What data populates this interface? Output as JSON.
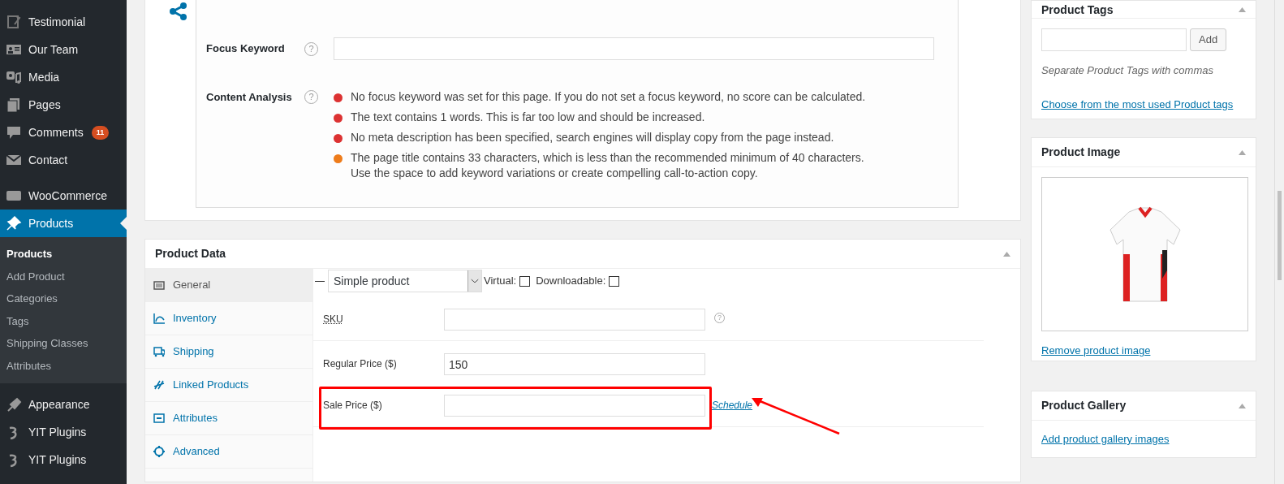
{
  "sidebar": {
    "items": [
      {
        "label": "Testimonial",
        "selected": false
      },
      {
        "label": "Our Team",
        "selected": false
      },
      {
        "label": "Media",
        "selected": false
      },
      {
        "label": "Pages",
        "selected": false
      },
      {
        "label": "Comments",
        "selected": false,
        "badge": "11"
      },
      {
        "label": "Contact",
        "selected": false
      },
      {
        "label": "WooCommerce",
        "selected": false,
        "gap_before": true
      },
      {
        "label": "Products",
        "selected": true,
        "children": [
          {
            "label": "Products",
            "selected": true
          },
          {
            "label": "Add Product",
            "selected": false
          },
          {
            "label": "Categories",
            "selected": false
          },
          {
            "label": "Tags",
            "selected": false
          },
          {
            "label": "Shipping Classes",
            "selected": false
          },
          {
            "label": "Attributes",
            "selected": false
          }
        ]
      },
      {
        "label": "Appearance",
        "selected": false,
        "gap_before": true
      },
      {
        "label": "YIT Plugins",
        "selected": false
      },
      {
        "label": "YIT Plugins",
        "selected": false
      }
    ]
  },
  "seo": {
    "focus_keyword": {
      "label": "Focus Keyword",
      "help": "?"
    },
    "content_analysis": {
      "label": "Content Analysis",
      "help": "?",
      "items": [
        {
          "text": "No focus keyword was set for this page. If you do not set a focus keyword, no score can be calculated.",
          "color": "#dc3232"
        },
        {
          "text": "The text contains 1 words. This is far too low and should be increased.",
          "color": "#dc3232"
        },
        {
          "text": "No meta description has been specified, search engines will display copy from the page instead.",
          "color": "#dc3232"
        },
        {
          "text": "The page title contains 33 characters, which is less than the recommended minimum of 40 characters.\nUse the space to add keyword variations or create compelling call-to-action copy.",
          "color": "#ee7c1b"
        }
      ]
    }
  },
  "product_data": {
    "title": "Product Data",
    "tabs": [
      {
        "label": "General",
        "selected": true
      },
      {
        "label": "Inventory",
        "selected": false
      },
      {
        "label": "Shipping",
        "selected": false
      },
      {
        "label": "Linked Products",
        "selected": false
      },
      {
        "label": "Attributes",
        "selected": false
      },
      {
        "label": "Advanced",
        "selected": false
      }
    ],
    "product_type": "Simple product",
    "options": [
      {
        "label": "Virtual:",
        "checked": false
      },
      {
        "label": "Downloadable:",
        "checked": false
      }
    ],
    "fields": [
      {
        "label": "SKU",
        "help": "?",
        "divider_after": true
      },
      {
        "label": "Regular Price ($)",
        "value": "150"
      },
      {
        "label": "Sale Price ($)",
        "highlighted": true,
        "link": "Schedule",
        "divider_after": true
      }
    ]
  },
  "product_tags": {
    "title": "Product Tags",
    "button": "Add",
    "hint": "Separate Product Tags with commas",
    "link": "Choose from the most used Product tags"
  },
  "product_image": {
    "title": "Product Image",
    "link": "Remove product image"
  },
  "product_gallery": {
    "title": "Product Gallery",
    "link": "Add product gallery images"
  }
}
